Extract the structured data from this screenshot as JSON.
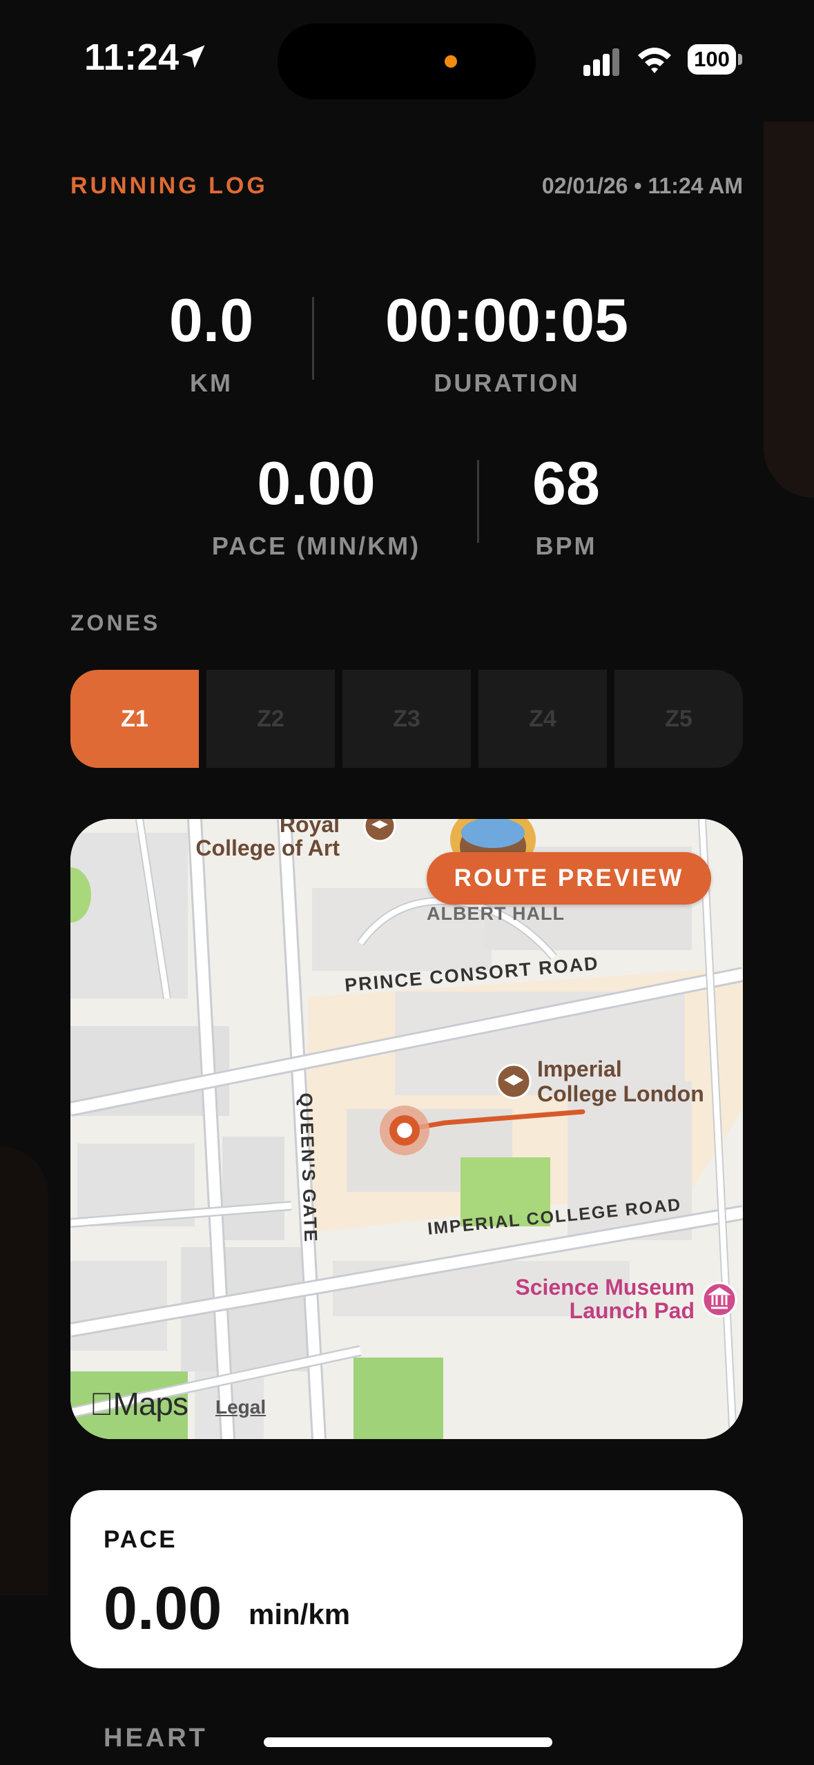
{
  "status_bar": {
    "time": "11:24",
    "battery": "100"
  },
  "header": {
    "title": "RUNNING LOG",
    "datetime": "02/01/26 • 11:24 AM"
  },
  "stats": {
    "distance": {
      "value": "0.0",
      "label": "KM"
    },
    "duration": {
      "value": "00:00:05",
      "label": "DURATION"
    },
    "pace": {
      "value": "0.00",
      "label": "PACE (MIN/KM)"
    },
    "heart_rate": {
      "value": "68",
      "label": "BPM"
    }
  },
  "zones": {
    "title": "ZONES",
    "items": [
      "Z1",
      "Z2",
      "Z3",
      "Z4",
      "Z5"
    ],
    "active": "Z1"
  },
  "map": {
    "route_button": "ROUTE PREVIEW",
    "labels": {
      "royal_college": "Royal College of Art",
      "albert_hall": "ALBERT HALL",
      "prince_consort": "PRINCE CONSORT ROAD",
      "imperial_line1": "Imperial",
      "imperial_line2": "College London",
      "queens_gate": "QUEEN'S GATE",
      "imperial_road": "IMPERIAL COLLEGE ROAD",
      "science_line1": "Science Museum",
      "science_line2": "Launch Pad"
    },
    "maps_logo": "Maps",
    "legal": "Legal"
  },
  "pace_card": {
    "title": "PACE",
    "value": "0.00",
    "unit": "min/km"
  },
  "heart_section": {
    "title": "HEART"
  },
  "colors": {
    "accent": "#E06A35",
    "background": "#0C0C0C",
    "card": "#FFFFFF",
    "muted": "#8E8E8E"
  }
}
